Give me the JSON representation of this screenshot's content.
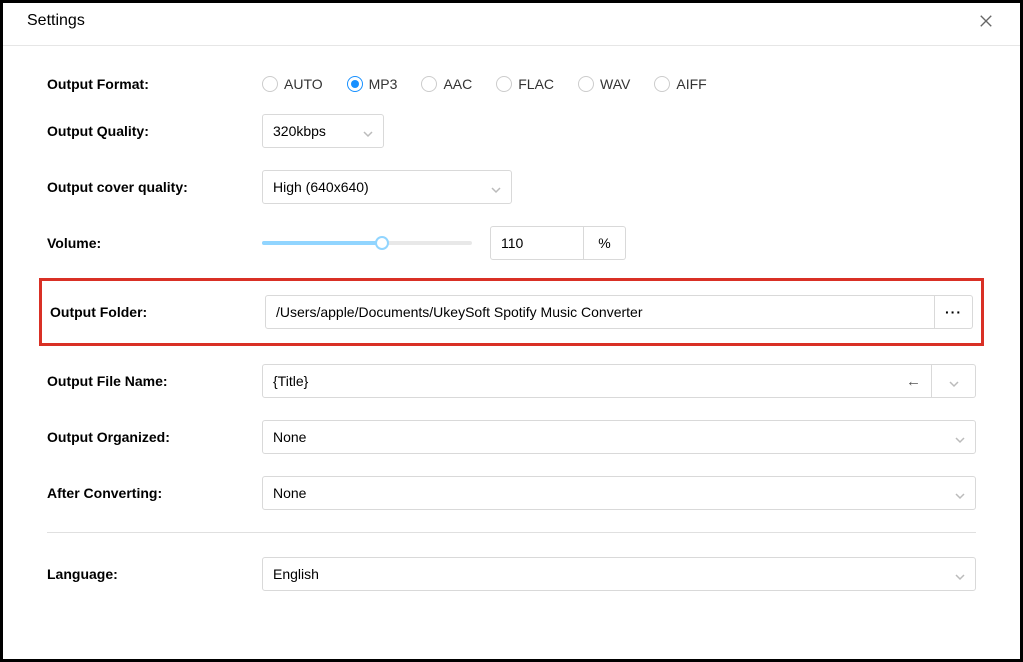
{
  "header": {
    "title": "Settings"
  },
  "labels": {
    "outputFormat": "Output Format:",
    "outputQuality": "Output Quality:",
    "outputCoverQuality": "Output cover quality:",
    "volume": "Volume:",
    "outputFolder": "Output Folder:",
    "outputFileName": "Output File Name:",
    "outputOrganized": "Output Organized:",
    "afterConverting": "After Converting:",
    "language": "Language:"
  },
  "format": {
    "options": [
      "AUTO",
      "MP3",
      "AAC",
      "FLAC",
      "WAV",
      "AIFF"
    ],
    "selected": "MP3"
  },
  "quality": {
    "value": "320kbps"
  },
  "coverQuality": {
    "value": "High (640x640)"
  },
  "volume": {
    "value": "110",
    "suffix": "%"
  },
  "outputFolder": {
    "value": "/Users/apple/Documents/UkeySoft Spotify Music Converter",
    "browseLabel": "···"
  },
  "fileName": {
    "value": "{Title}"
  },
  "organized": {
    "value": "None"
  },
  "afterConverting": {
    "value": "None"
  },
  "language": {
    "value": "English"
  }
}
